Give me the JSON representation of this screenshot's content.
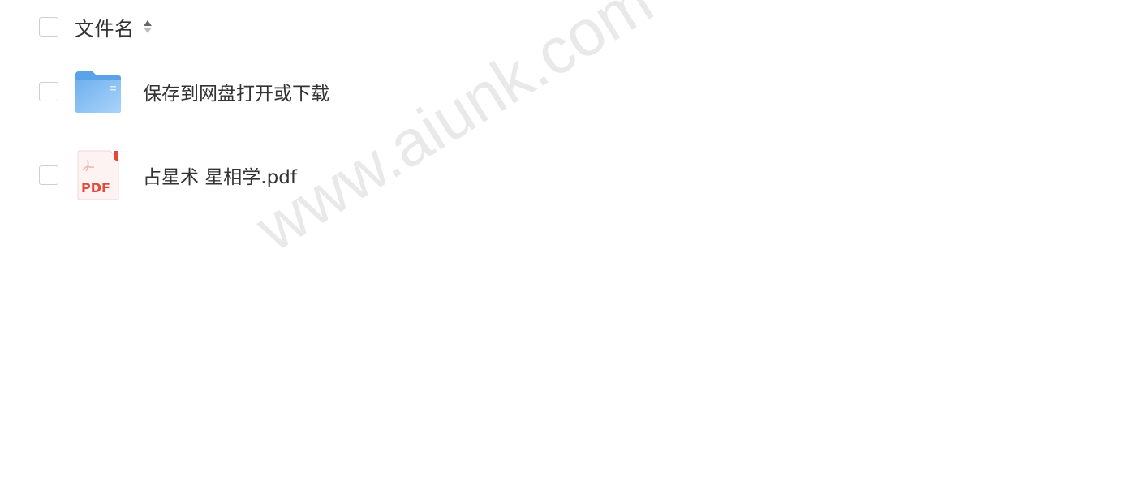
{
  "header": {
    "column_label": "文件名",
    "sort_icon": "sort-up-down-icon"
  },
  "files": [
    {
      "name": "保存到网盘打开或下载",
      "icon": "folder-icon",
      "icon_color": "#7ab8ef"
    },
    {
      "name": "占星术 星相学.pdf",
      "icon": "pdf-file-icon",
      "icon_color": "#e04a3c",
      "icon_label": "PDF"
    }
  ],
  "watermark": "www.aiunk.com"
}
